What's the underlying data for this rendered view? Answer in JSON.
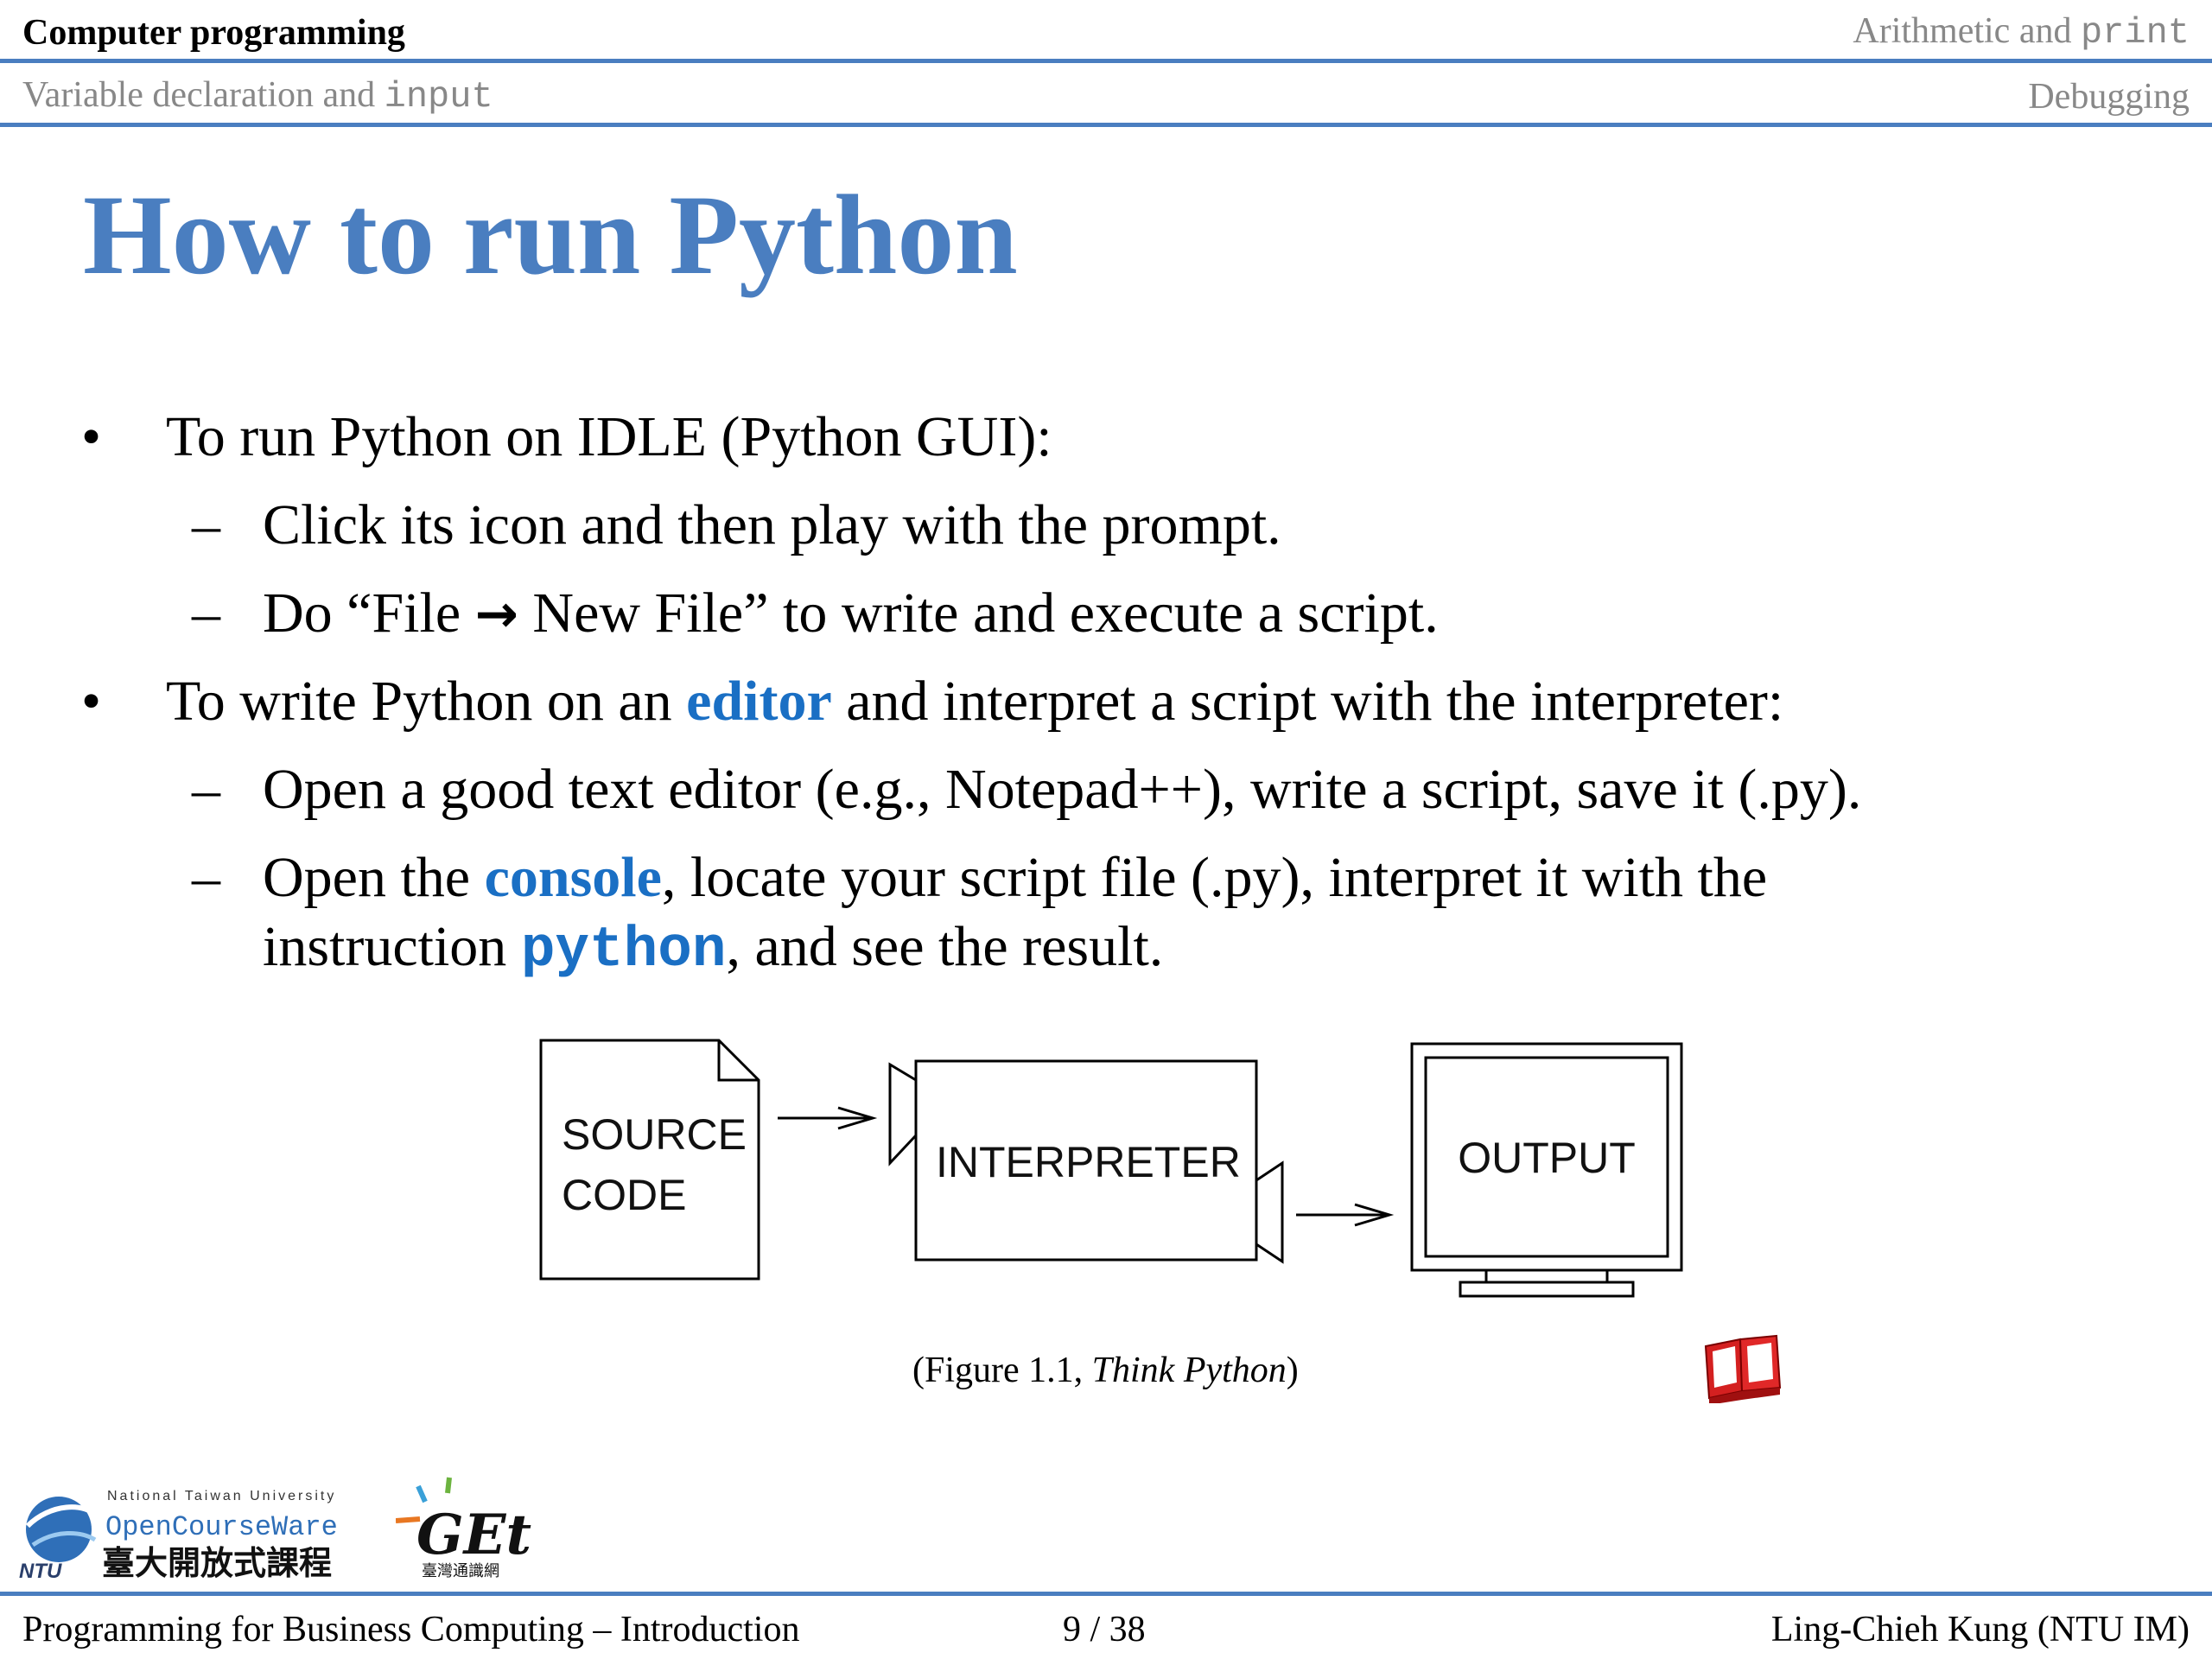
{
  "header": {
    "course": "Computer programming",
    "section_right_prefix": "Arithmetic and ",
    "section_right_code": "print",
    "subsection_left_prefix": "Variable declaration and ",
    "subsection_left_code": "input",
    "subsection_right": "Debugging"
  },
  "slide": {
    "title": "How to run Python",
    "bullet1": "To run Python on IDLE (Python GUI):",
    "bullet1_sub1": "Click its icon and then play with the prompt.",
    "bullet1_sub2_a": "Do “File ",
    "bullet1_sub2_arrow": "→",
    "bullet1_sub2_b": " New File” to write and execute a script.",
    "bullet2_a": "To write Python on an ",
    "bullet2_hl": "editor",
    "bullet2_b": " and interpret a script with the interpreter:",
    "bullet2_sub1": "Open a good text editor (e.g., Notepad++), write a script, save it (.py).",
    "bullet2_sub2_a": "Open the ",
    "bullet2_sub2_hl": "console",
    "bullet2_sub2_b": ", locate your script file (.py), interpret it with the",
    "bullet2_sub2_c": "instruction ",
    "bullet2_sub2_code": "python",
    "bullet2_sub2_d": ", and see the result.",
    "bullet_marker": "•",
    "dash_marker": "–"
  },
  "diagram": {
    "source_line1": "SOURCE",
    "source_line2": "CODE",
    "interpreter": "INTERPRETER",
    "output": "OUTPUT"
  },
  "caption": {
    "prefix": "(Figure 1.1, ",
    "italic": "Think Python",
    "suffix": ")"
  },
  "logos": {
    "ntu_top": "National Taiwan University",
    "ocw": "OpenCourseWare",
    "ntu_abbr": "NTU",
    "ocw_chinese": "臺大開放式課程",
    "get": "GEt",
    "get_chinese": "臺灣通識網"
  },
  "footer": {
    "left": "Programming for Business Computing – Introduction",
    "center": "9 / 38",
    "right": "Ling-Chieh Kung (NTU IM)"
  },
  "colors": {
    "accent": "#4a7ec0",
    "highlight": "#1a6fc4",
    "muted": "#888888",
    "book_red": "#d42020"
  },
  "icons": [
    "book-icon",
    "ocw-globe-icon",
    "get-logo-icon"
  ]
}
